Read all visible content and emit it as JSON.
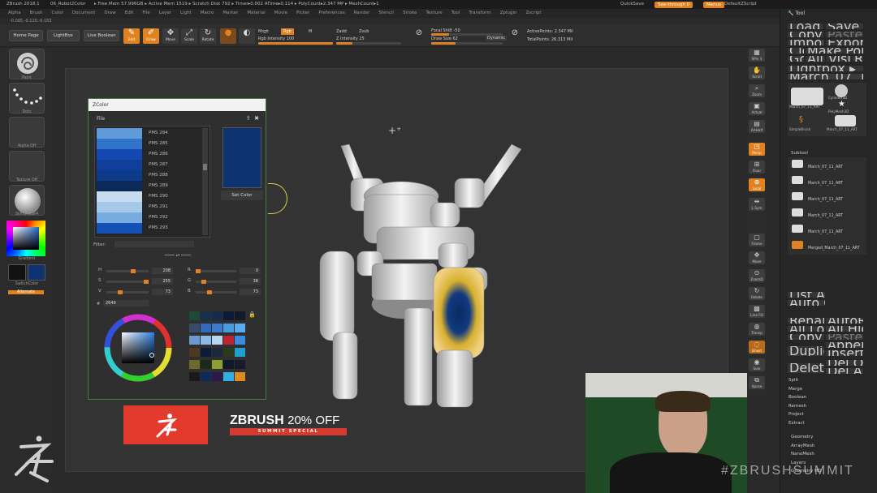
{
  "titlebar": {
    "app": "ZBrush 2018.1",
    "file": "06_Robot2Color",
    "stats": "▸ Free Mem 57.996GB ▸ Active Mem 1519 ▸ Scratch Disk 792 ▸ Timer▸0.002 ATime▸0.114 ▸ PolyCount▸2.347 MP ▸ MeshCount▸1",
    "quicksave": "QuickSave",
    "seethrough": "See-through 0",
    "menus_btn": "Menus",
    "script": "DefaultZScript"
  },
  "menubar": [
    "Alpha",
    "Brush",
    "Color",
    "Document",
    "Draw",
    "Edit",
    "File",
    "Layer",
    "Light",
    "Macro",
    "Marker",
    "Material",
    "Movie",
    "Picker",
    "Preferences",
    "Render",
    "Stencil",
    "Stroke",
    "Texture",
    "Tool",
    "Transform",
    "Zplugin",
    "Zscript"
  ],
  "coords": "-0.095,-0.120,-0.183",
  "shelf": {
    "home": "Home Page",
    "lightbox": "LightBox",
    "liveboolean": "Live Boolean",
    "edit": "Edit",
    "draw": "Draw",
    "move": "Move",
    "scale": "Scale",
    "rotate": "Rotate",
    "mrgb": "Mrgb",
    "rgb": "Rgb",
    "m": "M",
    "rgb_intensity": "Rgb Intensity 100",
    "zadd": "Zadd",
    "zsub": "Zsub",
    "zintensity": "Z Intensity 25",
    "focal": "Focal Shift -50",
    "drawsize": "Draw Size 62",
    "dynamic": "Dynamic",
    "activepoints": "ActivePoints: 2.347 Mil",
    "totalpoints": "TotalPoints: 26.313 Mil"
  },
  "leftbar": {
    "brush": "Paint",
    "stroke": "Dots",
    "alpha": "Alpha Off",
    "texture": "Texture Off",
    "material": "SkinShade4",
    "gradient": "Gradient",
    "switchcolor": "SwitchColor",
    "alternate": "Alternate"
  },
  "zcolor": {
    "title": "ZColor",
    "file": "File",
    "swatches": [
      {
        "name": "PMS 284",
        "color": "#5f9bd9"
      },
      {
        "name": "PMS 285",
        "color": "#2f74c9"
      },
      {
        "name": "PMS 286",
        "color": "#1348b0"
      },
      {
        "name": "PMS 287",
        "color": "#103e9a"
      },
      {
        "name": "PMS 288",
        "color": "#0c3b8a"
      },
      {
        "name": "PMS 289",
        "color": "#0b2a5a"
      },
      {
        "name": "PMS 290",
        "color": "#c6dcef"
      },
      {
        "name": "PMS 291",
        "color": "#a6c8eb"
      },
      {
        "name": "PMS 292",
        "color": "#76acdf"
      },
      {
        "name": "PMS 293",
        "color": "#1451b5"
      }
    ],
    "selected_color": "#0d3470",
    "set_color": "Set Color",
    "filter": "Filter:",
    "h_label": "H",
    "h_value": "208",
    "s_label": "S",
    "s_value": "255",
    "v_label": "V",
    "v_value": "73",
    "r_label": "R",
    "r_value": "0",
    "g_label": "G",
    "g_value": "38",
    "b_label": "B",
    "b_value": "73",
    "hash": "#",
    "hex": "2649"
  },
  "promo": {
    "brand": "ZBRUSH",
    "offer": "20% OFF",
    "subtitle": "SUMMIT SPECIAL"
  },
  "rightdock": [
    "SPix 3",
    "Scroll",
    "Zoom",
    "Actual",
    "AAHalf",
    "Persp",
    "Floor",
    "Local",
    "L.Sym",
    "Frame",
    "Move",
    "ZoomD",
    "Rotate",
    "Line Fill",
    "Transp",
    "Ghost",
    "Solo",
    "Xpose"
  ],
  "toolpanel": {
    "title": "Tool",
    "cells": [
      "Load Tool",
      "Save As",
      "Copy Tool",
      "Paste Tool",
      "Import",
      "Export",
      "Clone",
      "Make PolyMesh3D",
      "GoZ",
      "All",
      "Visible",
      "R"
    ],
    "lightbox_tools": "Lightbox ▸ Tools",
    "current_tool": "March_07_11_ART 48",
    "tool_thumbs": [
      "March_07_11_ART",
      "Cylinder3D",
      "PolyMesh3D",
      "SimpleBrush",
      "March_07_11_ART"
    ],
    "subtool_head": "Subtool",
    "subtools": [
      "March_07_11_ART",
      "March_07_11_ART",
      "March_07_11_ART",
      "March_07_11_ART",
      "March_07_11_ART",
      "Merged_March_07_11_ART"
    ],
    "list_all": "List All",
    "auto_collapse": "Auto Collapse",
    "actions": [
      "Rename",
      "AutoReorder",
      "All Low",
      "All High",
      "Copy",
      "Paste",
      "Duplicate",
      "Append",
      "Insert",
      "Delete",
      "Del Other",
      "Del All",
      "Split",
      "Merge",
      "Boolean",
      "Remesh",
      "Project",
      "Extract"
    ],
    "sections": [
      "Geometry",
      "ArrayMesh",
      "NanoMesh",
      "Layers",
      "Geometry HD"
    ]
  },
  "watermark": "#ZBRUSHSUMMIT"
}
